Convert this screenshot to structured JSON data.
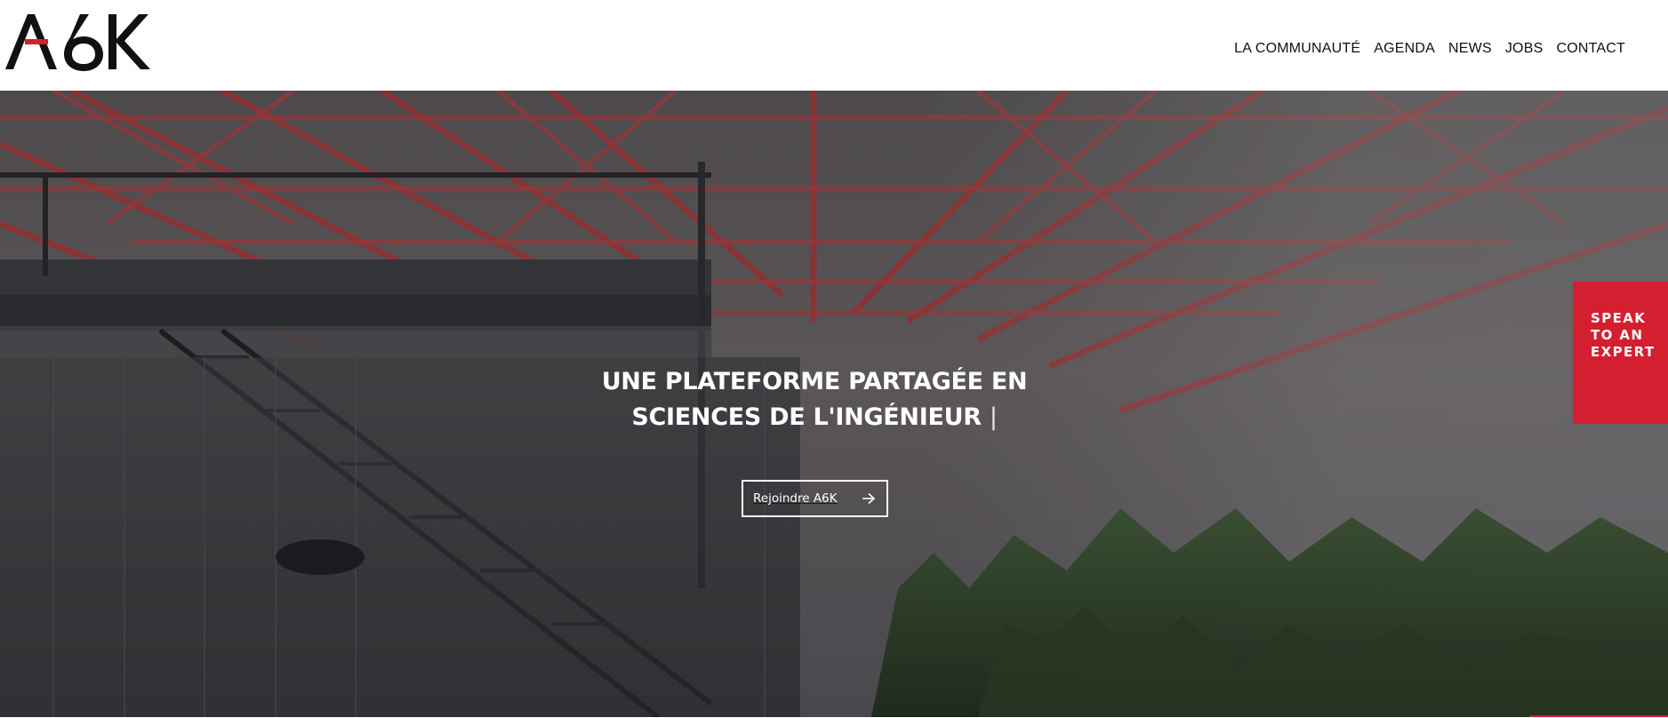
{
  "brand": {
    "logo_text": "A6K",
    "accent_color": "#d41f30",
    "logo_color": "#111111"
  },
  "nav": {
    "items": [
      {
        "label": "LA COMMUNAUTÉ"
      },
      {
        "label": "AGENDA"
      },
      {
        "label": "NEWS"
      },
      {
        "label": "JOBS"
      },
      {
        "label": "CONTACT"
      }
    ]
  },
  "hero": {
    "headline_line1": "UNE PLATEFORME PARTAGÉE EN",
    "headline_line2": "SCIENCES DE L'INGÉNIEUR",
    "typing_cursor": "|",
    "cta_label": "Rejoindre A6K",
    "cta_icon": "arrow-right-icon",
    "background_image": "industrial interior with red steel roof trusses, mezzanine staircase and plants"
  },
  "floating_button": {
    "label": "SPEAK TO AN EXPERT",
    "color": "#d41f30"
  }
}
